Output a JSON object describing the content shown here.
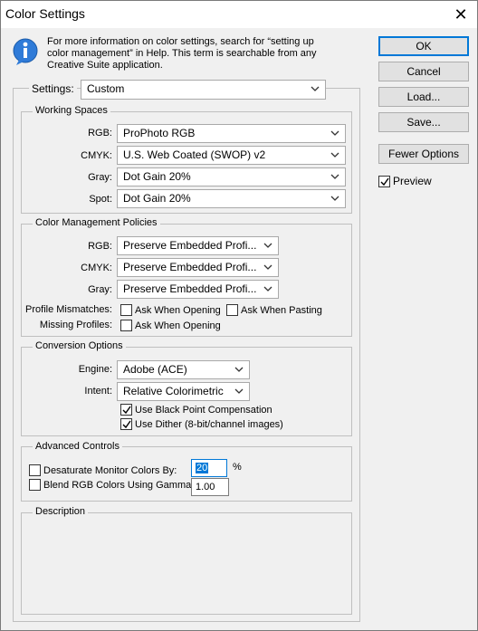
{
  "window": {
    "title": "Color Settings"
  },
  "info": {
    "text": "For more information on color settings, search for “setting up color management” in Help. This term is searchable from any Creative Suite application."
  },
  "settings": {
    "label": "Settings:",
    "value": "Custom"
  },
  "working_spaces": {
    "title": "Working Spaces",
    "rgb": {
      "label": "RGB:",
      "value": "ProPhoto RGB"
    },
    "cmyk": {
      "label": "CMYK:",
      "value": "U.S. Web Coated (SWOP) v2"
    },
    "gray": {
      "label": "Gray:",
      "value": "Dot Gain 20%"
    },
    "spot": {
      "label": "Spot:",
      "value": "Dot Gain 20%"
    }
  },
  "policies": {
    "title": "Color Management Policies",
    "rgb": {
      "label": "RGB:",
      "value": "Preserve Embedded Profi..."
    },
    "cmyk": {
      "label": "CMYK:",
      "value": "Preserve Embedded Profi..."
    },
    "gray": {
      "label": "Gray:",
      "value": "Preserve Embedded Profi..."
    },
    "mismatches_label": "Profile Mismatches:",
    "ask_opening": "Ask When Opening",
    "ask_pasting": "Ask When Pasting",
    "missing_label": "Missing Profiles:",
    "missing_ask_opening": "Ask When Opening"
  },
  "conversion": {
    "title": "Conversion Options",
    "engine": {
      "label": "Engine:",
      "value": "Adobe (ACE)"
    },
    "intent": {
      "label": "Intent:",
      "value": "Relative Colorimetric"
    },
    "bpc": "Use Black Point Compensation",
    "dither": "Use Dither (8-bit/channel images)"
  },
  "advanced": {
    "title": "Advanced Controls",
    "desaturate": "Desaturate Monitor Colors By:",
    "desaturate_value": "20",
    "percent": "%",
    "blend": "Blend RGB Colors Using Gamma:",
    "gamma_value": "1.00"
  },
  "description": {
    "title": "Description"
  },
  "buttons": {
    "ok": "OK",
    "cancel": "Cancel",
    "load": "Load...",
    "save": "Save...",
    "fewer": "Fewer Options",
    "preview": "Preview"
  },
  "colors": {
    "accent": "#0078d7",
    "face": "#f0f0f0"
  },
  "icons": [
    "info-icon",
    "close-icon",
    "chevron-down-icon",
    "checkmark-icon"
  ]
}
